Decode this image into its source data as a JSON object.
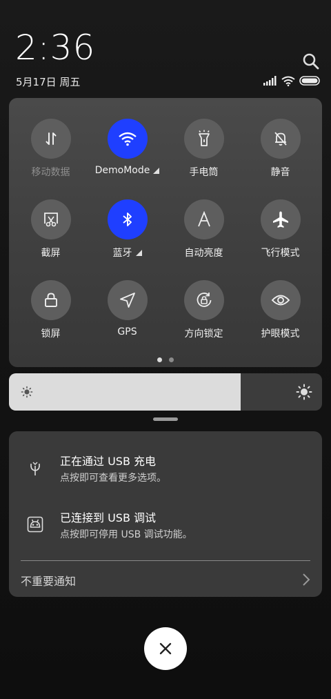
{
  "status_bar": {
    "time": "2:36",
    "date": "5月17日 周五"
  },
  "quick_settings": {
    "tiles": [
      {
        "id": "mobile-data",
        "label": "移动数据",
        "active": false,
        "dim": true,
        "icon": "mobile-data-icon"
      },
      {
        "id": "wifi",
        "label": "DemoMode",
        "active": true,
        "caret": true,
        "icon": "wifi-icon"
      },
      {
        "id": "flashlight",
        "label": "手电筒",
        "active": false,
        "icon": "flashlight-icon"
      },
      {
        "id": "mute",
        "label": "静音",
        "active": false,
        "icon": "bell-off-icon"
      },
      {
        "id": "screenshot",
        "label": "截屏",
        "active": false,
        "icon": "screenshot-icon"
      },
      {
        "id": "bluetooth",
        "label": "蓝牙",
        "active": true,
        "caret": true,
        "icon": "bluetooth-icon"
      },
      {
        "id": "auto-brightness",
        "label": "自动亮度",
        "active": false,
        "icon": "auto-brightness-icon"
      },
      {
        "id": "airplane",
        "label": "飞行模式",
        "active": false,
        "icon": "airplane-icon"
      },
      {
        "id": "lock-screen",
        "label": "锁屏",
        "active": false,
        "icon": "lock-icon"
      },
      {
        "id": "gps",
        "label": "GPS",
        "active": false,
        "icon": "gps-icon"
      },
      {
        "id": "rotation-lock",
        "label": "方向锁定",
        "active": false,
        "icon": "rotation-lock-icon"
      },
      {
        "id": "eye-care",
        "label": "护眼模式",
        "active": false,
        "icon": "eye-icon"
      }
    ],
    "page_count": 2,
    "current_page": 1
  },
  "brightness": {
    "level": 0.74
  },
  "notifications": {
    "items": [
      {
        "title": "正在通过 USB 充电",
        "subtitle": "点按即可查看更多选项。",
        "icon": "usb-charging-icon"
      },
      {
        "title": "已连接到 USB 调试",
        "subtitle": "点按即可停用 USB 调试功能。",
        "icon": "android-debug-icon"
      }
    ],
    "minor_label": "不重要通知"
  },
  "colors": {
    "active_tile": "#1f3fff",
    "inactive_tile": "#5e5e5e"
  }
}
